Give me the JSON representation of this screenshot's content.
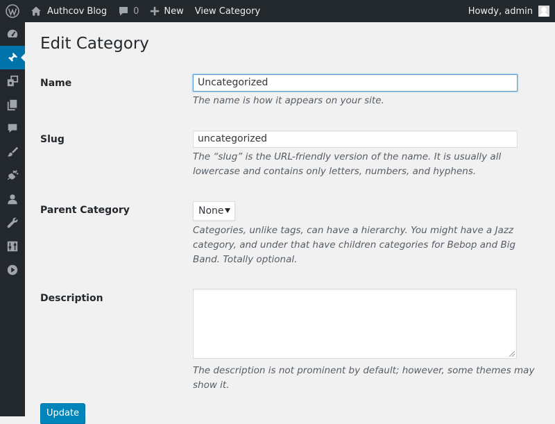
{
  "admin_bar": {
    "site_name": "Authcov Blog",
    "comments_count": "0",
    "new_label": "New",
    "view_label": "View Category",
    "greeting": "Howdy, admin"
  },
  "sidebar": {
    "items": [
      {
        "icon": "dashboard-icon"
      },
      {
        "icon": "posts-pin-icon",
        "active": true
      },
      {
        "icon": "media-icon"
      },
      {
        "icon": "pages-icon"
      },
      {
        "icon": "comments-icon"
      },
      {
        "icon": "appearance-icon"
      },
      {
        "icon": "plugins-icon"
      },
      {
        "icon": "users-icon"
      },
      {
        "icon": "tools-icon"
      },
      {
        "icon": "settings-icon"
      },
      {
        "icon": "play-icon"
      }
    ]
  },
  "page": {
    "title": "Edit Category",
    "name": {
      "label": "Name",
      "value": "Uncategorized",
      "help": "The name is how it appears on your site."
    },
    "slug": {
      "label": "Slug",
      "value": "uncategorized",
      "help": "The “slug” is the URL-friendly version of the name. It is usually all lowercase and contains only letters, numbers, and hyphens."
    },
    "parent": {
      "label": "Parent Category",
      "selected": "None",
      "help": "Categories, unlike tags, can have a hierarchy. You might have a Jazz category, and under that have children categories for Bebop and Big Band. Totally optional."
    },
    "description": {
      "label": "Description",
      "value": "",
      "help": "The description is not prominent by default; however, some themes may show it."
    },
    "update_label": "Update"
  },
  "colors": {
    "admin_bar_bg": "#23282d",
    "accent": "#0073aa",
    "button": "#0085ba"
  }
}
